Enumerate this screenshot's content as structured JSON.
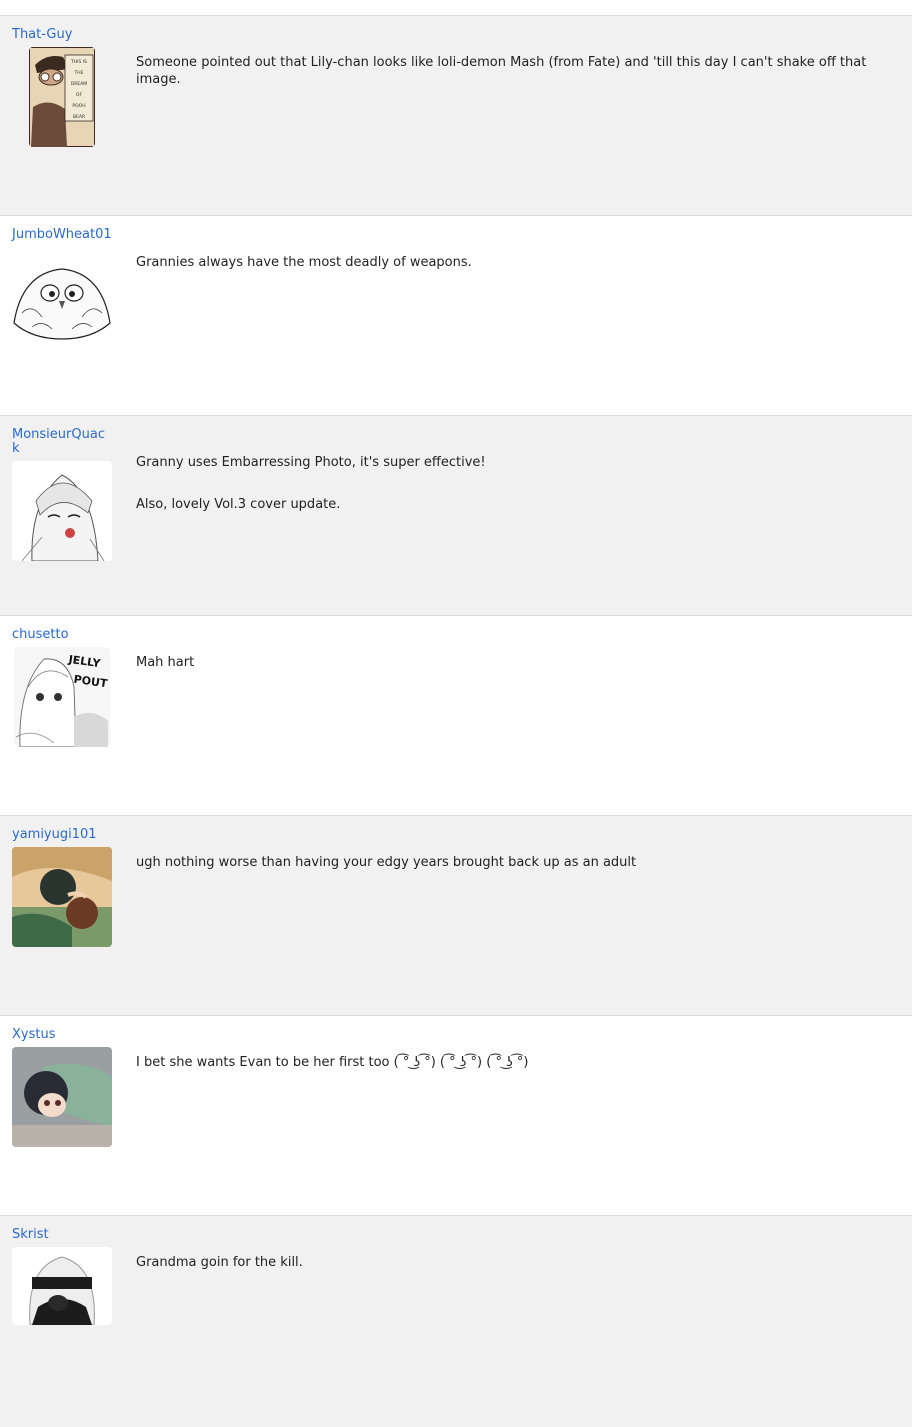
{
  "comments": [
    {
      "username": "That-Guy",
      "avatar_icon": "manga-hat-character-avatar",
      "paragraphs": [
        "Someone pointed out that Lily-chan looks like loli-demon Mash (from Fate) and 'till this day I can't shake off that image."
      ],
      "avatar_sign": [
        "THIS IS",
        "THE",
        "DREAM",
        "OF",
        "POOH",
        "BEAR"
      ]
    },
    {
      "username": "JumboWheat01",
      "avatar_icon": "owl-sketch-avatar",
      "paragraphs": [
        "Grannies always have the most deadly of weapons."
      ]
    },
    {
      "username": "MonsieurQuack",
      "avatar_icon": "manga-girl-avatar",
      "paragraphs": [
        "Granny uses Embarressing Photo, it's super effective!",
        "Also, lovely Vol.3 cover update."
      ]
    },
    {
      "username": "chusetto",
      "avatar_icon": "jelly-pout-manga-avatar",
      "paragraphs": [
        "Mah hart"
      ],
      "avatar_caption_1": "JELLY",
      "avatar_caption_2": "POUT"
    },
    {
      "username": "yamiyugi101",
      "avatar_icon": "anime-sleeping-avatar",
      "paragraphs": [
        "ugh nothing worse than having your edgy years brought back up as an adult"
      ]
    },
    {
      "username": "Xystus",
      "avatar_icon": "anime-girl-lying-avatar",
      "paragraphs": [
        "I bet she wants Evan to be her first too ( ͡° ͜ʖ ͡°) ( ͡° ͜ʖ ͡°) ( ͡° ͜ʖ ͡°)"
      ]
    },
    {
      "username": "Skrist",
      "avatar_icon": "blindfold-android-avatar",
      "paragraphs": [
        "Grandma goin for the kill."
      ]
    }
  ],
  "colors": {
    "link": "#2a6acb",
    "alt_row": "#f1f1f1",
    "border": "#dcdcdc"
  }
}
